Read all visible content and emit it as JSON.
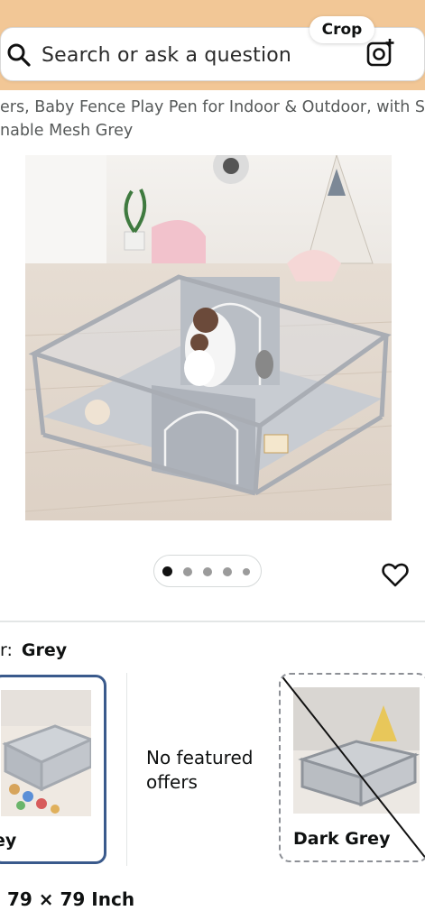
{
  "search": {
    "placeholder": "Search or ask a question",
    "crop_label": "Crop",
    "icons": [
      "search-icon",
      "camera-search-icon"
    ]
  },
  "product": {
    "title_line_1": "ers, Baby Fence Play Pen for Indoor & Outdoor, with Soft",
    "title_line_2": "nable Mesh Grey",
    "image_count": 5,
    "active_image_index": 0
  },
  "variants": {
    "color_label": "r:",
    "color_value": "Grey",
    "options": [
      {
        "name": "ey",
        "selected": true
      },
      {
        "name": "Dark Grey",
        "selected": false,
        "unavailable": true
      }
    ],
    "no_offers_text": "No featured offers"
  },
  "size": {
    "value": "79 × 79 Inch"
  },
  "colors": {
    "top_band": "#f2c796",
    "selected_border": "#3a5a8c",
    "playpen_grey": "#c8ccd2"
  }
}
